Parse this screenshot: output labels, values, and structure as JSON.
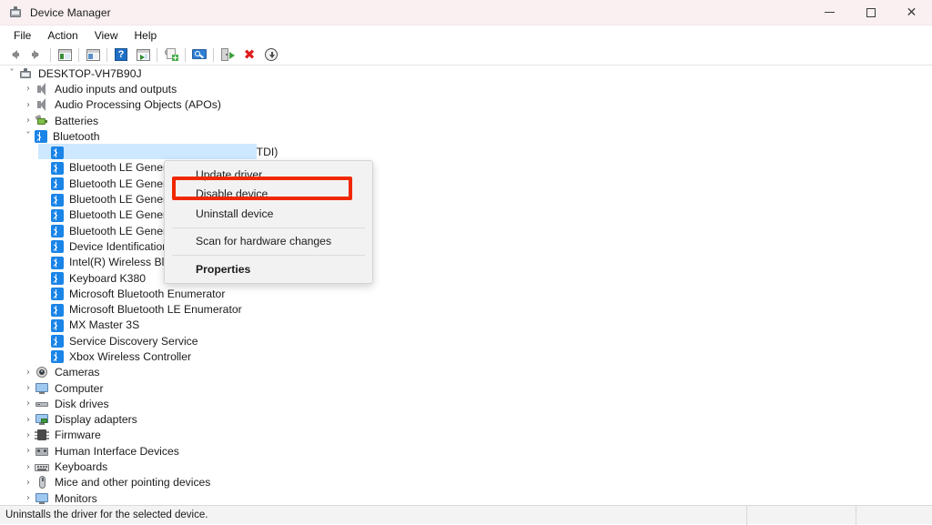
{
  "window": {
    "title": "Device Manager",
    "icon": "device-manager-icon",
    "controls": {
      "minimize": "–",
      "maximize": "□",
      "close": "✕"
    }
  },
  "menubar": {
    "items": [
      {
        "label": "File"
      },
      {
        "label": "Action"
      },
      {
        "label": "View"
      },
      {
        "label": "Help"
      }
    ]
  },
  "toolbar": {
    "items": [
      {
        "name": "back-arrow-icon"
      },
      {
        "name": "forward-arrow-icon"
      },
      {
        "name": "show-hide-console-tree-icon"
      },
      {
        "name": "properties-window-icon"
      },
      {
        "name": "help-icon"
      },
      {
        "name": "show-hide-action-pane-icon"
      },
      {
        "name": "update-driver-icon"
      },
      {
        "name": "scan-for-hardware-changes-icon"
      },
      {
        "name": "disable-device-icon"
      },
      {
        "name": "uninstall-device-icon"
      },
      {
        "name": "download-icon"
      }
    ]
  },
  "tree": {
    "root": {
      "label": "DESKTOP-VH7B90J",
      "icon": "computer-icon",
      "expanded": true
    },
    "items": [
      {
        "label": "Audio inputs and outputs",
        "icon": "speaker-icon",
        "depth": 1,
        "chevron": ">",
        "selected": false
      },
      {
        "label": "Audio Processing Objects (APOs)",
        "icon": "speaker-icon",
        "depth": 1,
        "chevron": ">",
        "selected": false
      },
      {
        "label": "Batteries",
        "icon": "battery-icon",
        "depth": 1,
        "chevron": ">",
        "selected": false
      },
      {
        "label": "Bluetooth",
        "icon": "bluetooth-icon",
        "depth": 1,
        "chevron": "v",
        "selected": false
      },
      {
        "label": "Bluetooth Device (RFCOMM Protocol TDI)",
        "icon": "bluetooth-icon",
        "depth": 2,
        "chevron": "",
        "selected": true
      },
      {
        "label": "Bluetooth LE Generic Attribute Service",
        "icon": "bluetooth-icon",
        "depth": 2,
        "chevron": "",
        "selected": false
      },
      {
        "label": "Bluetooth LE Generic Attribute Service",
        "icon": "bluetooth-icon",
        "depth": 2,
        "chevron": "",
        "selected": false
      },
      {
        "label": "Bluetooth LE Generic Attribute Service",
        "icon": "bluetooth-icon",
        "depth": 2,
        "chevron": "",
        "selected": false
      },
      {
        "label": "Bluetooth LE Generic Attribute Service",
        "icon": "bluetooth-icon",
        "depth": 2,
        "chevron": "",
        "selected": false
      },
      {
        "label": "Bluetooth LE Generic Attribute Service",
        "icon": "bluetooth-icon",
        "depth": 2,
        "chevron": "",
        "selected": false
      },
      {
        "label": "Device Identification Service",
        "icon": "bluetooth-icon",
        "depth": 2,
        "chevron": "",
        "selected": false
      },
      {
        "label": "Intel(R) Wireless Bluetooth(R)",
        "icon": "bluetooth-icon",
        "depth": 2,
        "chevron": "",
        "selected": false
      },
      {
        "label": "Keyboard K380",
        "icon": "bluetooth-icon",
        "depth": 2,
        "chevron": "",
        "selected": false
      },
      {
        "label": "Microsoft Bluetooth Enumerator",
        "icon": "bluetooth-icon",
        "depth": 2,
        "chevron": "",
        "selected": false
      },
      {
        "label": "Microsoft Bluetooth LE Enumerator",
        "icon": "bluetooth-icon",
        "depth": 2,
        "chevron": "",
        "selected": false
      },
      {
        "label": "MX Master 3S",
        "icon": "bluetooth-icon",
        "depth": 2,
        "chevron": "",
        "selected": false
      },
      {
        "label": "Service Discovery Service",
        "icon": "bluetooth-icon",
        "depth": 2,
        "chevron": "",
        "selected": false
      },
      {
        "label": "Xbox Wireless Controller",
        "icon": "bluetooth-icon",
        "depth": 2,
        "chevron": "",
        "selected": false
      },
      {
        "label": "Cameras",
        "icon": "camera-icon",
        "depth": 1,
        "chevron": ">",
        "selected": false
      },
      {
        "label": "Computer",
        "icon": "monitor-icon",
        "depth": 1,
        "chevron": ">",
        "selected": false
      },
      {
        "label": "Disk drives",
        "icon": "disk-icon",
        "depth": 1,
        "chevron": ">",
        "selected": false
      },
      {
        "label": "Display adapters",
        "icon": "display-adapter-icon",
        "depth": 1,
        "chevron": ">",
        "selected": false
      },
      {
        "label": "Firmware",
        "icon": "firmware-chip-icon",
        "depth": 1,
        "chevron": ">",
        "selected": false
      },
      {
        "label": "Human Interface Devices",
        "icon": "hid-icon",
        "depth": 1,
        "chevron": ">",
        "selected": false
      },
      {
        "label": "Keyboards",
        "icon": "keyboard-icon",
        "depth": 1,
        "chevron": ">",
        "selected": false
      },
      {
        "label": "Mice and other pointing devices",
        "icon": "mouse-icon",
        "depth": 1,
        "chevron": ">",
        "selected": false
      },
      {
        "label": "Monitors",
        "icon": "monitor-icon",
        "depth": 1,
        "chevron": ">",
        "selected": false
      }
    ]
  },
  "context_menu": {
    "items": [
      {
        "label": "Update driver",
        "type": "item",
        "bold": false,
        "highlighted": false
      },
      {
        "label": "Disable device",
        "type": "item",
        "bold": false,
        "highlighted": true
      },
      {
        "label": "Uninstall device",
        "type": "item",
        "bold": false,
        "highlighted": false
      },
      {
        "type": "separator"
      },
      {
        "label": "Scan for hardware changes",
        "type": "item",
        "bold": false,
        "highlighted": false
      },
      {
        "type": "separator"
      },
      {
        "label": "Properties",
        "type": "item",
        "bold": true,
        "highlighted": false
      }
    ]
  },
  "annotation": {
    "highlight_color": "#f02800",
    "target_label": "Disable device"
  },
  "statusbar": {
    "text": "Uninstalls the driver for the selected device."
  }
}
